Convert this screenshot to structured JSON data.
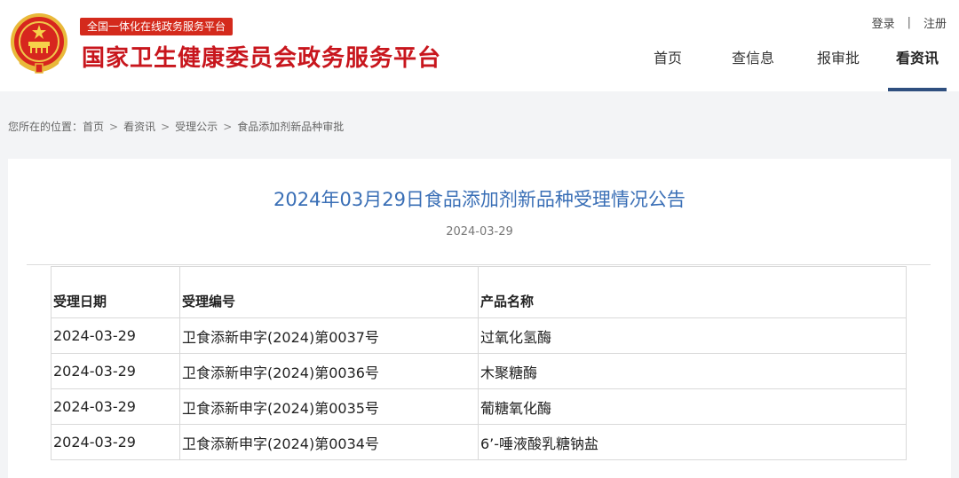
{
  "header": {
    "subtitle": "全国一体化在线政务服务平台",
    "title": "国家卫生健康委员会政务服务平台",
    "auth": {
      "login": "登录",
      "separator": "|",
      "register": "注册"
    },
    "nav": [
      {
        "label": "首页"
      },
      {
        "label": "查信息"
      },
      {
        "label": "报审批"
      },
      {
        "label": "看资讯",
        "active": true
      }
    ]
  },
  "breadcrumb": {
    "prefix": "您所在的位置：",
    "items": [
      "首页",
      "看资讯",
      "受理公示",
      "食品添加剂新品种审批"
    ],
    "separator": ">"
  },
  "article": {
    "title": "2024年03月29日食品添加剂新品种受理情况公告",
    "date": "2024-03-29"
  },
  "table": {
    "headers": [
      "受理日期",
      "受理编号",
      "产品名称"
    ],
    "rows": [
      [
        "2024-03-29",
        "卫食添新申字(2024)第0037号",
        "过氧化氢酶"
      ],
      [
        "2024-03-29",
        "卫食添新申字(2024)第0036号",
        "木聚糖酶"
      ],
      [
        "2024-03-29",
        "卫食添新申字(2024)第0035号",
        "葡糖氧化酶"
      ],
      [
        "2024-03-29",
        "卫食添新申字(2024)第0034号",
        "6’-唾液酸乳糖钠盐"
      ]
    ]
  },
  "colors": {
    "brand_red": "#c8161d",
    "title_blue": "#3a6fb6",
    "nav_underline": "#2f4f7f"
  }
}
